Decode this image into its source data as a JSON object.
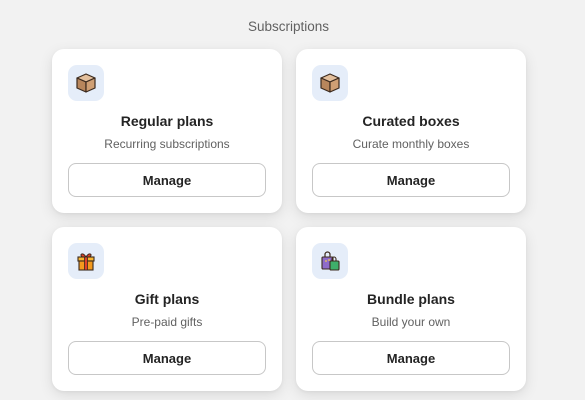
{
  "header": {
    "title": "Subscriptions"
  },
  "cards": [
    {
      "title": "Regular plans",
      "description": "Recurring subscriptions",
      "button_label": "Manage",
      "icon": "package-box-icon"
    },
    {
      "title": "Curated boxes",
      "description": "Curate monthly boxes",
      "button_label": "Manage",
      "icon": "package-box-icon"
    },
    {
      "title": "Gift plans",
      "description": "Pre-paid gifts",
      "button_label": "Manage",
      "icon": "gift-icon"
    },
    {
      "title": "Bundle plans",
      "description": "Build your own",
      "button_label": "Manage",
      "icon": "shopping-bags-icon"
    }
  ],
  "colors": {
    "background": "#f2f2f2",
    "card": "#ffffff",
    "icon_tile": "#e5edf9",
    "text_primary": "#242424",
    "text_secondary": "#616161",
    "button_border": "#c7c7c7"
  }
}
